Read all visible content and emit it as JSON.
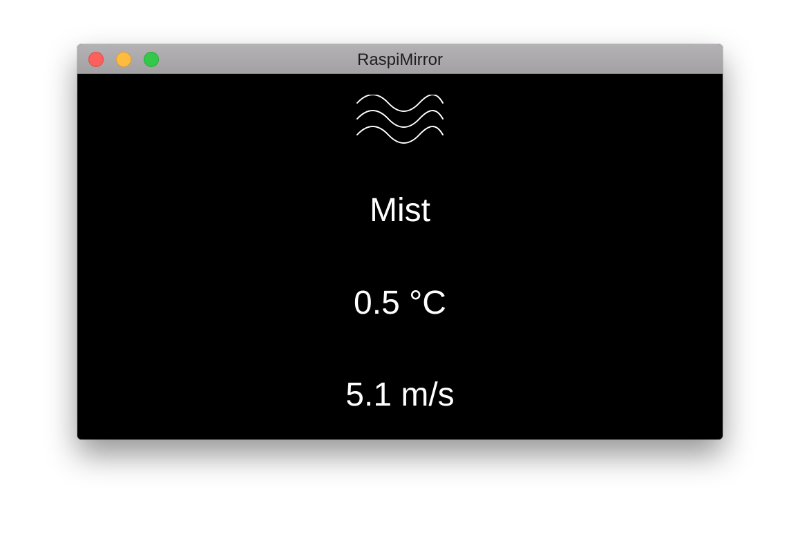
{
  "window": {
    "title": "RaspiMirror",
    "controls": {
      "close": "close-button",
      "minimize": "minimize-button",
      "maximize": "maximize-button"
    }
  },
  "weather": {
    "icon": "mist-icon",
    "condition": "Mist",
    "temperature": "0.5 °C",
    "wind_speed": "5.1 m/s"
  },
  "colors": {
    "background": "#000000",
    "text": "#ffffff",
    "titlebar": "#a9a7a9"
  }
}
